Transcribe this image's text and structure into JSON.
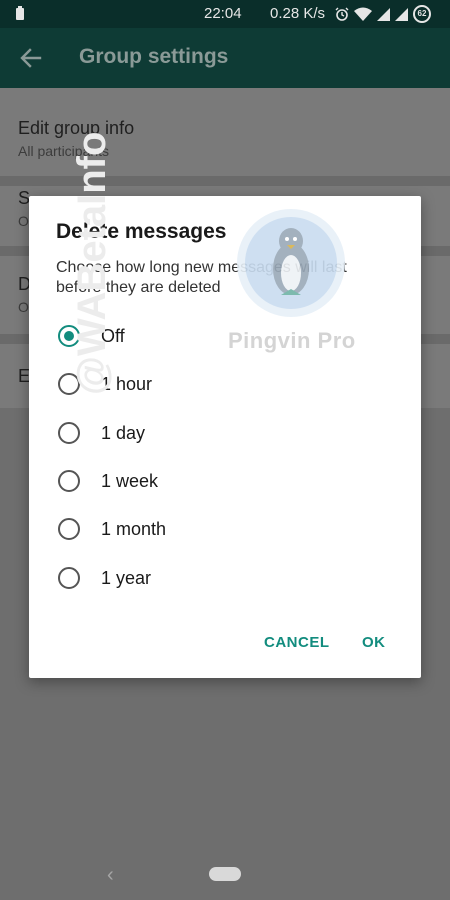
{
  "status_bar": {
    "time": "22:04",
    "net_speed": "0.28 K/s",
    "battery_level": "62"
  },
  "app_bar": {
    "title": "Group settings"
  },
  "settings_list": [
    {
      "title": "Edit group info",
      "subtitle": "All participants"
    },
    {
      "title": "S",
      "subtitle": "O"
    },
    {
      "title": "D",
      "subtitle": "O"
    },
    {
      "title": "E",
      "subtitle": ""
    }
  ],
  "dialog": {
    "title": "Delete messages",
    "description": "Choose how long new messages will last before they are deleted",
    "options": [
      {
        "label": "Off",
        "selected": true
      },
      {
        "label": "1 hour",
        "selected": false
      },
      {
        "label": "1 day",
        "selected": false
      },
      {
        "label": "1 week",
        "selected": false
      },
      {
        "label": "1 month",
        "selected": false
      },
      {
        "label": "1 year",
        "selected": false
      }
    ],
    "cancel_label": "CANCEL",
    "ok_label": "OK"
  },
  "watermark": {
    "brand": "Pingvin Pro",
    "vertical": "@WABetaInfo"
  },
  "colors": {
    "accent": "#128c7e",
    "app_bar": "#0e3b35",
    "scrim": "#6e6e6e"
  }
}
